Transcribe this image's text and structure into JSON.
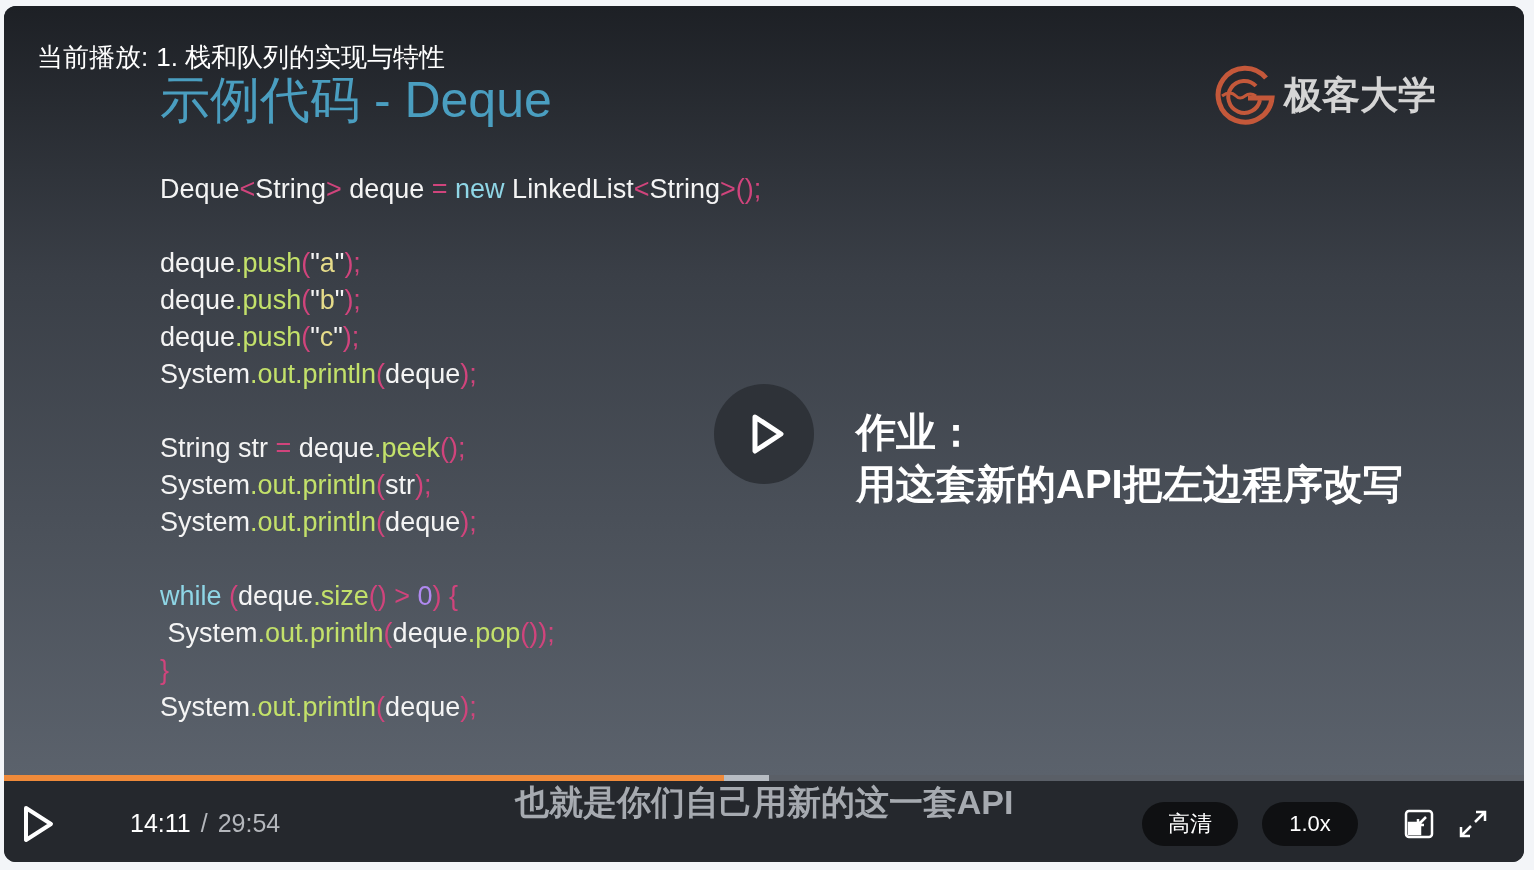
{
  "now_playing": {
    "label": "当前播放:",
    "title": "1. 栈和队列的实现与特性"
  },
  "slide": {
    "title": "示例代码 - Deque",
    "logo_text": "极客大学",
    "code_blocks": [
      [
        [
          {
            "text": "Deque",
            "kind": "plain"
          },
          {
            "text": "<",
            "kind": "punct"
          },
          {
            "text": "String",
            "kind": "plain"
          },
          {
            "text": ">",
            "kind": "punct"
          },
          {
            "text": " deque ",
            "kind": "plain"
          },
          {
            "text": "=",
            "kind": "punct"
          },
          {
            "text": " new ",
            "kind": "keyword"
          },
          {
            "text": "LinkedList",
            "kind": "plain"
          },
          {
            "text": "<",
            "kind": "punct"
          },
          {
            "text": "String",
            "kind": "plain"
          },
          {
            "text": ">();",
            "kind": "punct"
          }
        ]
      ],
      [
        [
          {
            "text": "deque",
            "kind": "plain"
          },
          {
            "text": ".push",
            "kind": "method"
          },
          {
            "text": "(",
            "kind": "punct"
          },
          {
            "text": "\"",
            "kind": "plain"
          },
          {
            "text": "a",
            "kind": "string"
          },
          {
            "text": "\"",
            "kind": "plain"
          },
          {
            "text": ");",
            "kind": "punct"
          }
        ],
        [
          {
            "text": "deque",
            "kind": "plain"
          },
          {
            "text": ".push",
            "kind": "method"
          },
          {
            "text": "(",
            "kind": "punct"
          },
          {
            "text": "\"",
            "kind": "plain"
          },
          {
            "text": "b",
            "kind": "string"
          },
          {
            "text": "\"",
            "kind": "plain"
          },
          {
            "text": ");",
            "kind": "punct"
          }
        ],
        [
          {
            "text": "deque",
            "kind": "plain"
          },
          {
            "text": ".push",
            "kind": "method"
          },
          {
            "text": "(",
            "kind": "punct"
          },
          {
            "text": "\"",
            "kind": "plain"
          },
          {
            "text": "c",
            "kind": "string"
          },
          {
            "text": "\"",
            "kind": "plain"
          },
          {
            "text": ");",
            "kind": "punct"
          }
        ],
        [
          {
            "text": "System",
            "kind": "plain"
          },
          {
            "text": ".out.println",
            "kind": "method"
          },
          {
            "text": "(",
            "kind": "punct"
          },
          {
            "text": "deque",
            "kind": "plain"
          },
          {
            "text": ");",
            "kind": "punct"
          }
        ]
      ],
      [
        [
          {
            "text": "String str ",
            "kind": "plain"
          },
          {
            "text": "=",
            "kind": "punct"
          },
          {
            "text": " deque",
            "kind": "plain"
          },
          {
            "text": ".peek",
            "kind": "method"
          },
          {
            "text": "();",
            "kind": "punct"
          }
        ],
        [
          {
            "text": "System",
            "kind": "plain"
          },
          {
            "text": ".out.println",
            "kind": "method"
          },
          {
            "text": "(",
            "kind": "punct"
          },
          {
            "text": "str",
            "kind": "plain"
          },
          {
            "text": ");",
            "kind": "punct"
          }
        ],
        [
          {
            "text": "System",
            "kind": "plain"
          },
          {
            "text": ".out.println",
            "kind": "method"
          },
          {
            "text": "(",
            "kind": "punct"
          },
          {
            "text": "deque",
            "kind": "plain"
          },
          {
            "text": ");",
            "kind": "punct"
          }
        ]
      ],
      [
        [
          {
            "text": "while ",
            "kind": "keyword"
          },
          {
            "text": "(",
            "kind": "punct"
          },
          {
            "text": "deque",
            "kind": "plain"
          },
          {
            "text": ".size",
            "kind": "method"
          },
          {
            "text": "() > ",
            "kind": "punct"
          },
          {
            "text": "0",
            "kind": "number"
          },
          {
            "text": ") {",
            "kind": "punct"
          }
        ],
        [
          {
            "text": " System",
            "kind": "plain"
          },
          {
            "text": ".out.println",
            "kind": "method"
          },
          {
            "text": "(",
            "kind": "punct"
          },
          {
            "text": "deque",
            "kind": "plain"
          },
          {
            "text": ".pop",
            "kind": "method"
          },
          {
            "text": "());",
            "kind": "punct"
          }
        ],
        [
          {
            "text": "}",
            "kind": "punct"
          }
        ],
        [
          {
            "text": "System",
            "kind": "plain"
          },
          {
            "text": ".out.println",
            "kind": "method"
          },
          {
            "text": "(",
            "kind": "punct"
          },
          {
            "text": "deque",
            "kind": "plain"
          },
          {
            "text": ");",
            "kind": "punct"
          }
        ]
      ]
    ],
    "homework": [
      "作业：",
      "用这套新的API把左边程序改写"
    ]
  },
  "subtitle": "也就是你们自己用新的这一套API",
  "progress": {
    "level": 0.474,
    "buffered": {
      "level": 0.503
    }
  },
  "controls": {
    "current_time": "14:11",
    "separator": "/",
    "duration": "29:54",
    "quality": "高清",
    "speed": "1.0x"
  }
}
